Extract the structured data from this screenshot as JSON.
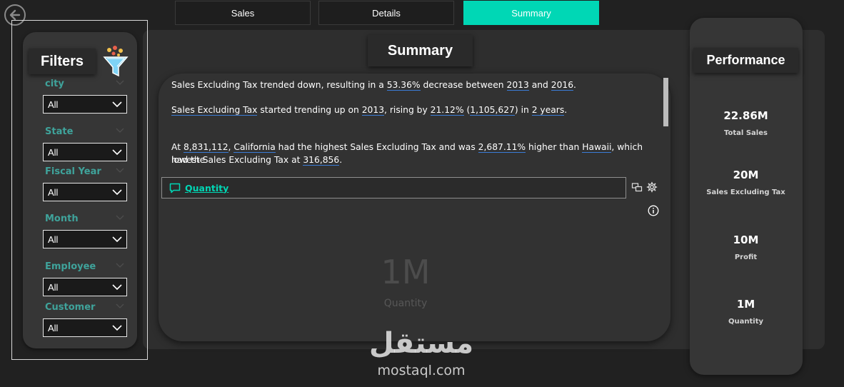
{
  "tabs": [
    {
      "label": "Sales",
      "active": false
    },
    {
      "label": "Details",
      "active": false
    },
    {
      "label": "Summary",
      "active": true
    }
  ],
  "filters": {
    "title": "Filters",
    "slicers": [
      {
        "label": "city",
        "value": "All"
      },
      {
        "label": "State",
        "value": "All"
      },
      {
        "label": "Fiscal Year",
        "value": "All"
      },
      {
        "label": "Month",
        "value": "All"
      },
      {
        "label": "Employee",
        "value": "All"
      },
      {
        "label": "Customer",
        "value": "All"
      }
    ]
  },
  "summary": {
    "title": "Summary",
    "narrative": {
      "line1": {
        "a": "Sales Excluding  Tax trended down, resulting in a ",
        "b": "53.36%",
        "c": " decrease between ",
        "d": "2013",
        "e": " and ",
        "f": "2016",
        "g": "."
      },
      "line2": {
        "a": "Sales Excluding  Tax",
        "b": " started trending up on ",
        "c": "2013",
        "d": ", rising by ",
        "e": "21.12%",
        "f": " (",
        "g": "1,105,627",
        "h": ") in ",
        "i": "2 years",
        "j": "."
      },
      "line3": {
        "a": "At ",
        "b": "8,831,112",
        "c": ", ",
        "d": "California",
        "e": " had the highest Sales Excluding  Tax and was ",
        "f": "2,687.11%",
        "g": " higher than ",
        "h": "Hawaii",
        "i": ", which had the"
      },
      "line4": {
        "a": "lowest Sales Excluding  Tax at ",
        "b": "316,856",
        "c": "."
      }
    },
    "qa_text": "Quantity",
    "card": {
      "value": "1M",
      "label": "Quantity"
    }
  },
  "performance": {
    "title": "Performance",
    "kpis": [
      {
        "value": "22.86M",
        "label": "Total Sales"
      },
      {
        "value": "20M",
        "label": "Sales Excluding  Tax"
      },
      {
        "value": "10M",
        "label": "Profit"
      },
      {
        "value": "1M",
        "label": "Quantity"
      }
    ]
  },
  "watermark": {
    "logo": "مستقل",
    "url": "mostaql.com"
  },
  "colors": {
    "accent": "#00d7b5",
    "slicer_label": "#3fa39b",
    "link_underline": "#3b7cd6",
    "background": "#212121"
  }
}
